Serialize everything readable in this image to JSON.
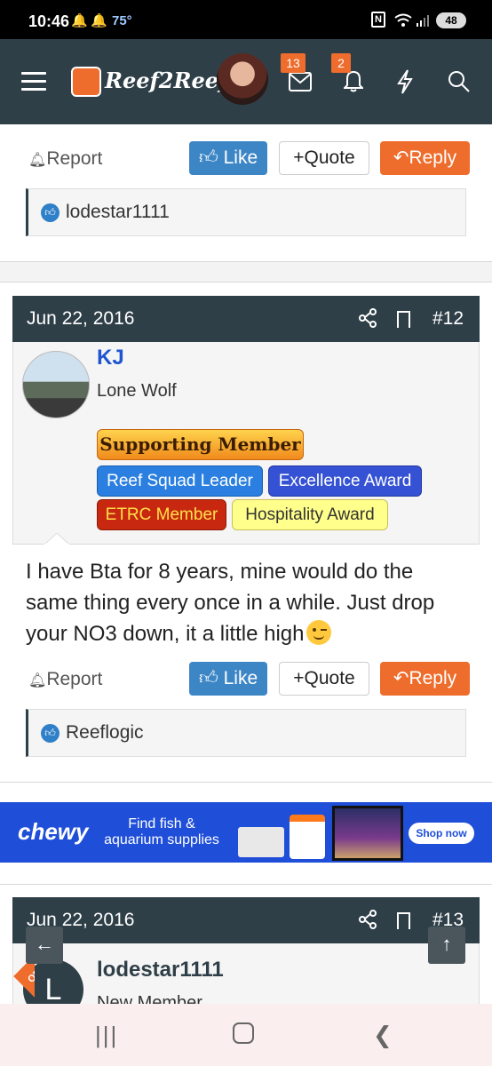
{
  "status": {
    "time": "10:46",
    "temperature": "75°",
    "battery": "48"
  },
  "header": {
    "logo_text": "Reef2Reef",
    "messages_badge": "13",
    "alerts_badge": "2"
  },
  "actions": {
    "report": "Report",
    "like": "Like",
    "quote": "Quote",
    "reply": "Reply"
  },
  "prev_post": {
    "likers": "lodestar1111"
  },
  "post12": {
    "date": "Jun 22, 2016",
    "number": "#12",
    "username": "KJ",
    "user_title": "Lone Wolf",
    "awards": {
      "supporting": "Supporting Member",
      "reef_squad": "Reef Squad Leader",
      "excellence": "Excellence Award",
      "etrc": "ETRC Member",
      "hospitality": "Hospitality Award"
    },
    "body_line1": "I have Bta for 8 years, mine would do the",
    "body_line2": "same thing every once in a while. Just drop",
    "body_line3": "your NO3 down, it a little high",
    "likers": "Reeflogic"
  },
  "ad": {
    "brand": "chewy",
    "copy_line1": "Find fish &",
    "copy_line2": "aquarium supplies",
    "cta": "Shop now"
  },
  "post13": {
    "date": "Jun 22, 2016",
    "number": "#13",
    "username": "lodestar1111",
    "user_title": "New Member",
    "avatar_letter": "L",
    "op_label": "OP"
  },
  "colors": {
    "header_bg": "#2f3f48",
    "accent": "#ee6c2c",
    "like_blue": "#3d86c6",
    "username_blue": "#1f55d0",
    "ad_blue": "#1f4ed8"
  }
}
